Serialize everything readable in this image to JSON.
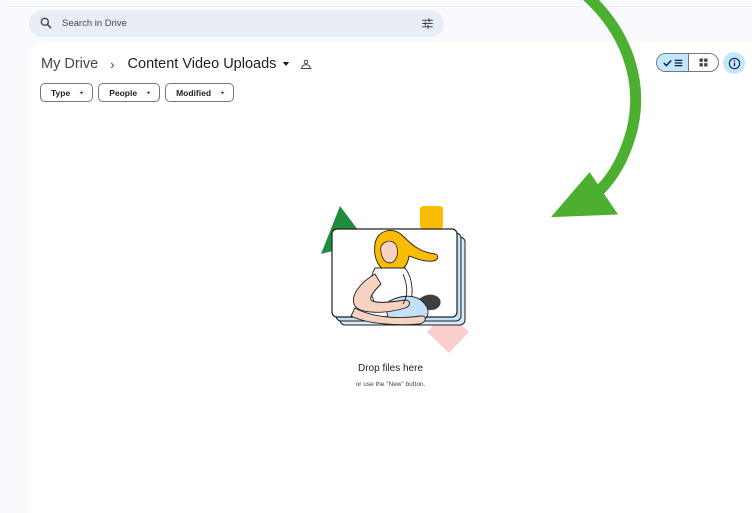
{
  "search": {
    "placeholder": "Search in Drive"
  },
  "breadcrumb": {
    "root": "My Drive",
    "separator": "›",
    "current": "Content Video Uploads"
  },
  "filters": [
    {
      "label": "Type"
    },
    {
      "label": "People"
    },
    {
      "label": "Modified"
    }
  ],
  "view": {
    "selected": "list"
  },
  "empty_state": {
    "title": "Drop files here",
    "subtitle": "or use the “New” button."
  },
  "colors": {
    "accent": "#c2e7ff",
    "search_bg": "#e9eef6",
    "arrow": "#4caf2f",
    "triangle": "#1e8e3e",
    "square": "#fbbc04",
    "diamond": "#f8cfcc",
    "frame": "#c2e0f7"
  },
  "icons": [
    "search-icon",
    "tune-icon",
    "caret-down-icon",
    "shared-folder-icon",
    "check-icon",
    "list-icon",
    "grid-icon",
    "info-icon"
  ]
}
